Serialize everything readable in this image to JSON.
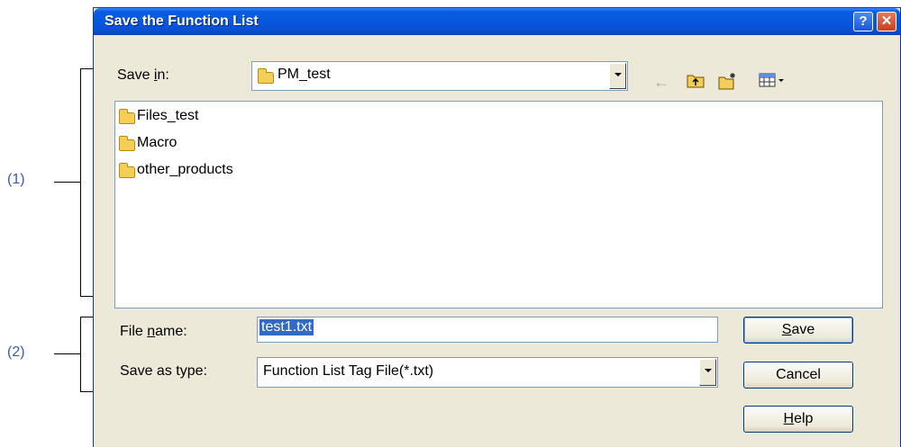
{
  "annotations": {
    "a1": "(1)",
    "a2": "(2)"
  },
  "dialog": {
    "title": "Save the Function List",
    "help_glyph": "?",
    "close_glyph": "✕"
  },
  "save_in": {
    "label_pre": "Save ",
    "label_u": "i",
    "label_post": "n:",
    "value": "PM_test"
  },
  "toolbar": {
    "back_icon": "back-arrow-icon",
    "up_icon": "up-folder-icon",
    "new_icon": "new-folder-icon",
    "views_icon": "views-menu-icon"
  },
  "files": [
    {
      "name": "Files_test"
    },
    {
      "name": "Macro"
    },
    {
      "name": "other_products"
    }
  ],
  "file_name": {
    "label_pre": "File ",
    "label_u": "n",
    "label_post": "ame:",
    "value": "test1.txt"
  },
  "save_type": {
    "label": "Save as type:",
    "value": "Function List Tag File(*.txt)"
  },
  "buttons": {
    "save_u": "S",
    "save_rest": "ave",
    "cancel": "Cancel",
    "help_u": "H",
    "help_rest": "elp"
  },
  "colors": {
    "titlebar": "#0657de",
    "dialog_bg": "#ece9d8",
    "selection": "#316ac5",
    "annotation": "#3b5bb5"
  }
}
